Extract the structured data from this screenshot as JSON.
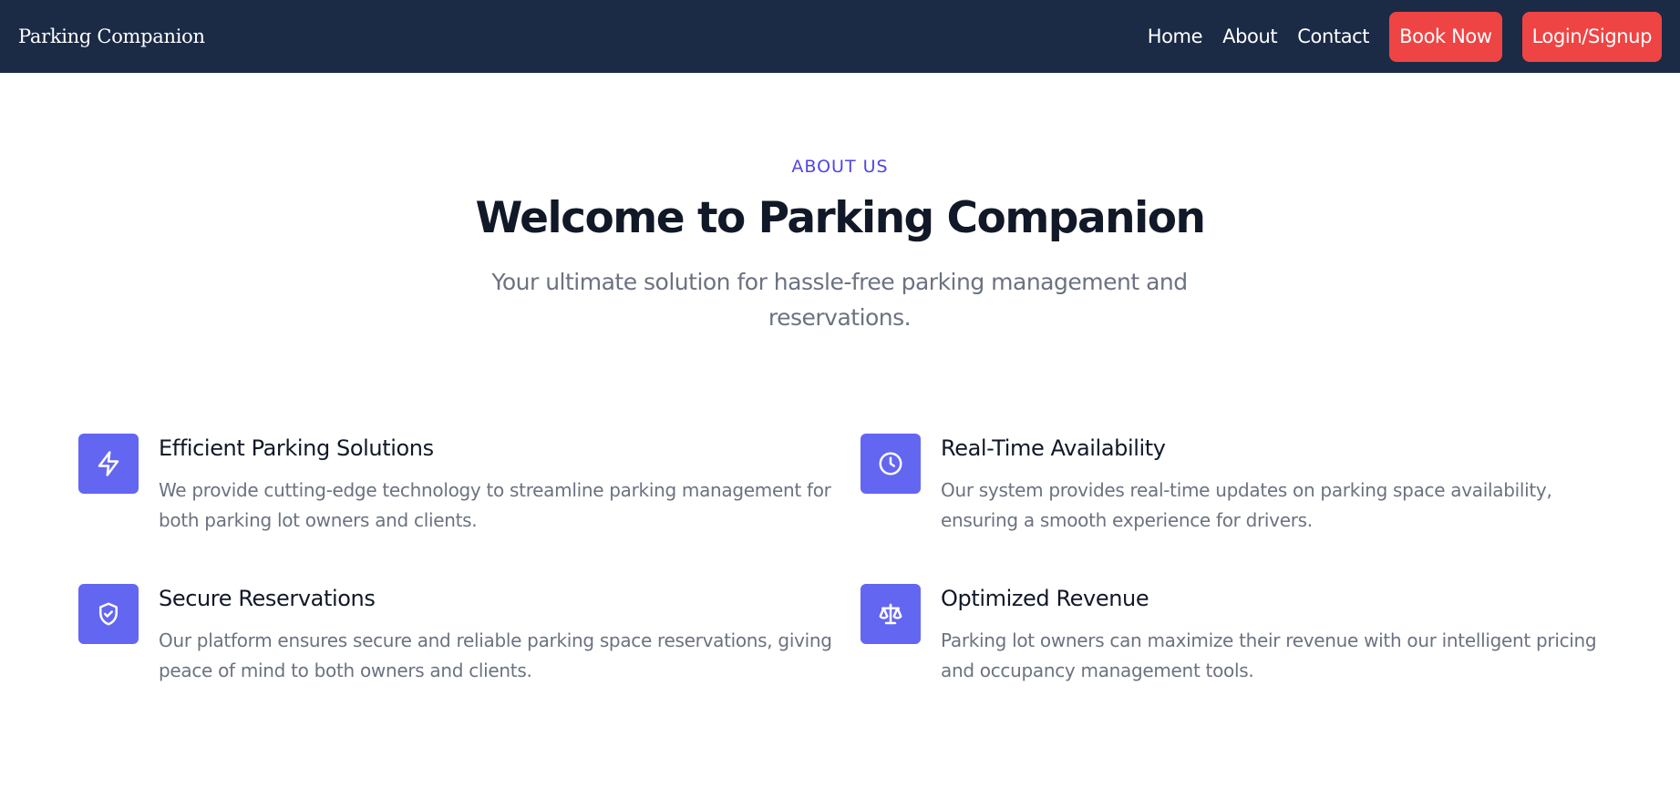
{
  "navbar": {
    "brand": "Parking Companion",
    "links": [
      "Home",
      "About",
      "Contact"
    ],
    "book_label": "Book Now",
    "login_label": "Login/Signup"
  },
  "hero": {
    "eyebrow": "ABOUT US",
    "title": "Welcome to Parking Companion",
    "subtitle": "Your ultimate solution for hassle-free parking management and reservations."
  },
  "features": [
    {
      "icon": "lightning-bolt-icon",
      "title": "Efficient Parking Solutions",
      "description": "We provide cutting-edge technology to streamline parking management for both parking lot owners and clients."
    },
    {
      "icon": "clock-icon",
      "title": "Real-Time Availability",
      "description": "Our system provides real-time updates on parking space availability, ensuring a smooth experience for drivers."
    },
    {
      "icon": "shield-check-icon",
      "title": "Secure Reservations",
      "description": "Our platform ensures secure and reliable parking space reservations, giving peace of mind to both owners and clients."
    },
    {
      "icon": "scale-icon",
      "title": "Optimized Revenue",
      "description": "Parking lot owners can maximize their revenue with our intelligent pricing and occupancy management tools."
    }
  ],
  "colors": {
    "navbar_bg": "#1b2a45",
    "accent_red": "#ef4444",
    "accent_indigo": "#6366f1",
    "eyebrow_indigo": "#4f46e5",
    "heading": "#111827",
    "muted_text": "#6b7280"
  }
}
